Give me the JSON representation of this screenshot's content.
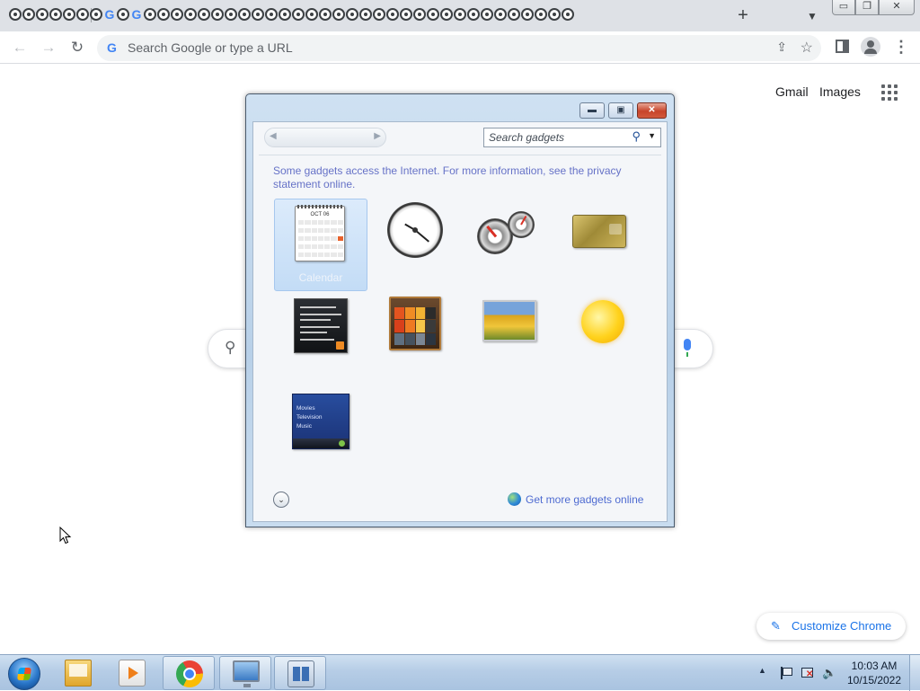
{
  "browser": {
    "tab_count": 42,
    "new_tab_label": "+",
    "tab_search_icon": "chevron-down-icon",
    "window_controls": {
      "minimize": "▭",
      "restore": "❐",
      "close": "✕"
    },
    "toolbar": {
      "back_icon": "←",
      "forward_icon": "→",
      "reload_icon": "↻",
      "omnibox_placeholder": "Search Google or type a URL",
      "omnibox_g": "G",
      "share_icon": "⇪",
      "star_icon": "☆",
      "menu_icon": "⋮"
    }
  },
  "ntp": {
    "gmail": "Gmail",
    "images": "Images",
    "search_icon": "⚲",
    "customize_label": "Customize Chrome",
    "customize_icon": "✎"
  },
  "gadget_window": {
    "controls": {
      "minimize": "▬",
      "restore": "▣",
      "close": "✕"
    },
    "nav_prev": "◀",
    "nav_next": "▶",
    "search_placeholder": "Search gadgets",
    "search_icon": "⚲",
    "search_dropdown": "▼",
    "info_text": "Some gadgets access the Internet.  For more information, see the privacy statement online.",
    "gadgets": [
      {
        "label": "Calendar",
        "icon": "calendar-gadget-icon",
        "selected": true
      },
      {
        "label": "",
        "icon": "clock-gadget-icon",
        "selected": false
      },
      {
        "label": "",
        "icon": "cpu-meter-gadget-icon",
        "selected": false
      },
      {
        "label": "",
        "icon": "currency-gadget-icon",
        "selected": false
      },
      {
        "label": "",
        "icon": "feed-headlines-gadget-icon",
        "selected": false
      },
      {
        "label": "",
        "icon": "picture-puzzle-gadget-icon",
        "selected": false
      },
      {
        "label": "",
        "icon": "slide-show-gadget-icon",
        "selected": false
      },
      {
        "label": "",
        "icon": "weather-gadget-icon",
        "selected": false
      },
      {
        "label": "",
        "icon": "media-center-gadget-icon",
        "selected": false
      }
    ],
    "calendar_month": "OCT 06",
    "media_lines": [
      "Movies",
      "Television",
      "Music"
    ],
    "show_details_icon": "⌄",
    "get_more_link": "Get more gadgets online"
  },
  "taskbar": {
    "items": [
      {
        "name": "windows-explorer",
        "open": false
      },
      {
        "name": "windows-media-player",
        "open": false
      },
      {
        "name": "google-chrome",
        "open": true
      },
      {
        "name": "remote-desktop",
        "open": true
      },
      {
        "name": "desktop-gadgets",
        "open": true
      }
    ],
    "tray_expand": "▲",
    "volume_icon": "🔈",
    "time": "10:03 AM",
    "date": "10/15/2022"
  },
  "colors": {
    "chrome_tabstrip": "#dee1e6",
    "gadget_link": "#4e6bd1",
    "gadget_info": "#6672c7",
    "taskbar": "#b6cde6",
    "customize_text": "#1a73e8"
  }
}
